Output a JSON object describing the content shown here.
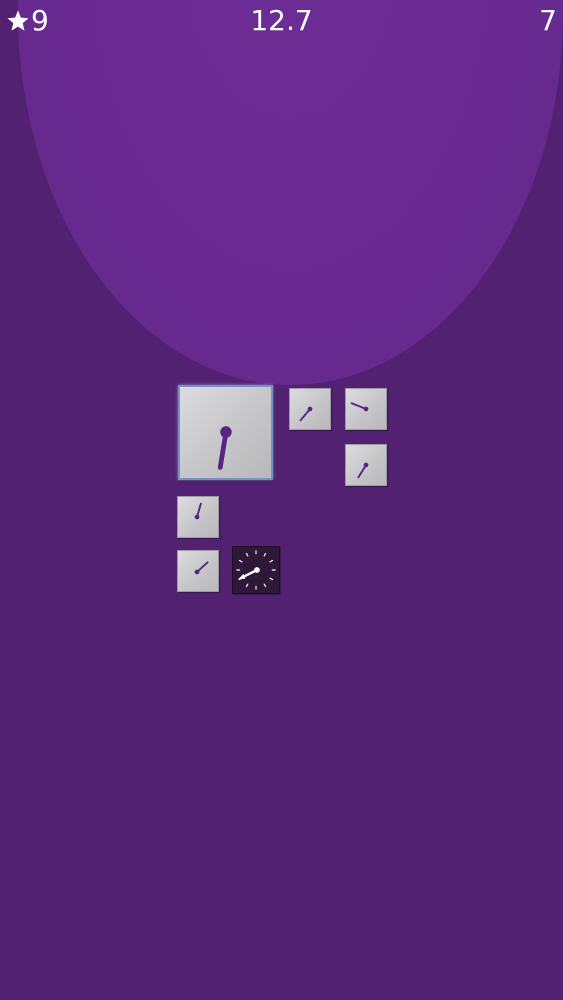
{
  "hud": {
    "stars": "9",
    "time": "12.7",
    "level": "7"
  },
  "colors": {
    "background": "#532172",
    "spotlight": "#682a91",
    "hand": "#5a2383",
    "tile": "#cfcfd2",
    "dark_tile": "#2e1838"
  },
  "icons": {
    "star": "star-icon"
  }
}
